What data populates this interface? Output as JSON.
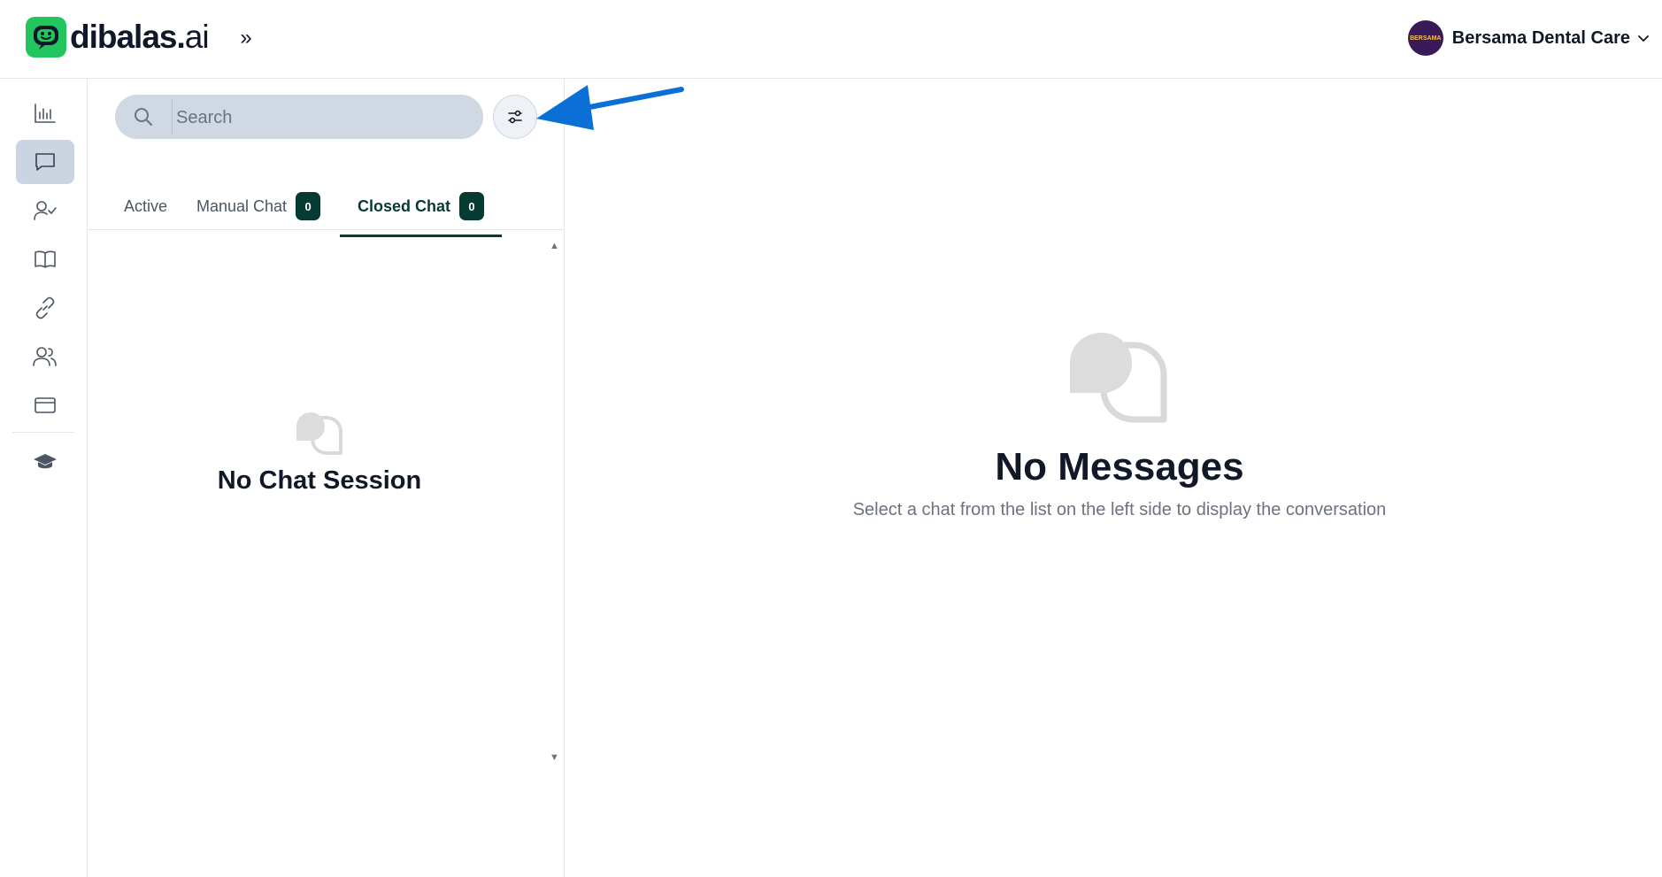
{
  "header": {
    "logo_text_main": "dibalas.",
    "logo_text_suffix": "ai",
    "expand_label": "»",
    "avatar_text": "BERSAMA",
    "account_name": "Bersama Dental Care"
  },
  "sidebar": {
    "items": [
      {
        "icon": "analytics-icon"
      },
      {
        "icon": "chat-icon",
        "active": true
      },
      {
        "icon": "user-check-icon"
      },
      {
        "icon": "book-icon"
      },
      {
        "icon": "link-icon"
      },
      {
        "icon": "users-icon"
      },
      {
        "icon": "credit-card-icon"
      },
      {
        "icon": "graduation-cap-icon"
      }
    ]
  },
  "chat_list": {
    "search_placeholder": "Search",
    "tabs": [
      {
        "label": "Active"
      },
      {
        "label": "Manual Chat",
        "badge": "0"
      },
      {
        "label": "Closed Chat",
        "badge": "0",
        "active": true
      }
    ],
    "empty_title": "No Chat Session"
  },
  "main": {
    "empty_title": "No Messages",
    "empty_subtitle": "Select a chat from the list on the left side to display the conversation"
  },
  "colors": {
    "brand_green": "#22c55e",
    "tab_active": "#063b33",
    "annotation_arrow": "#0a6fd6"
  }
}
